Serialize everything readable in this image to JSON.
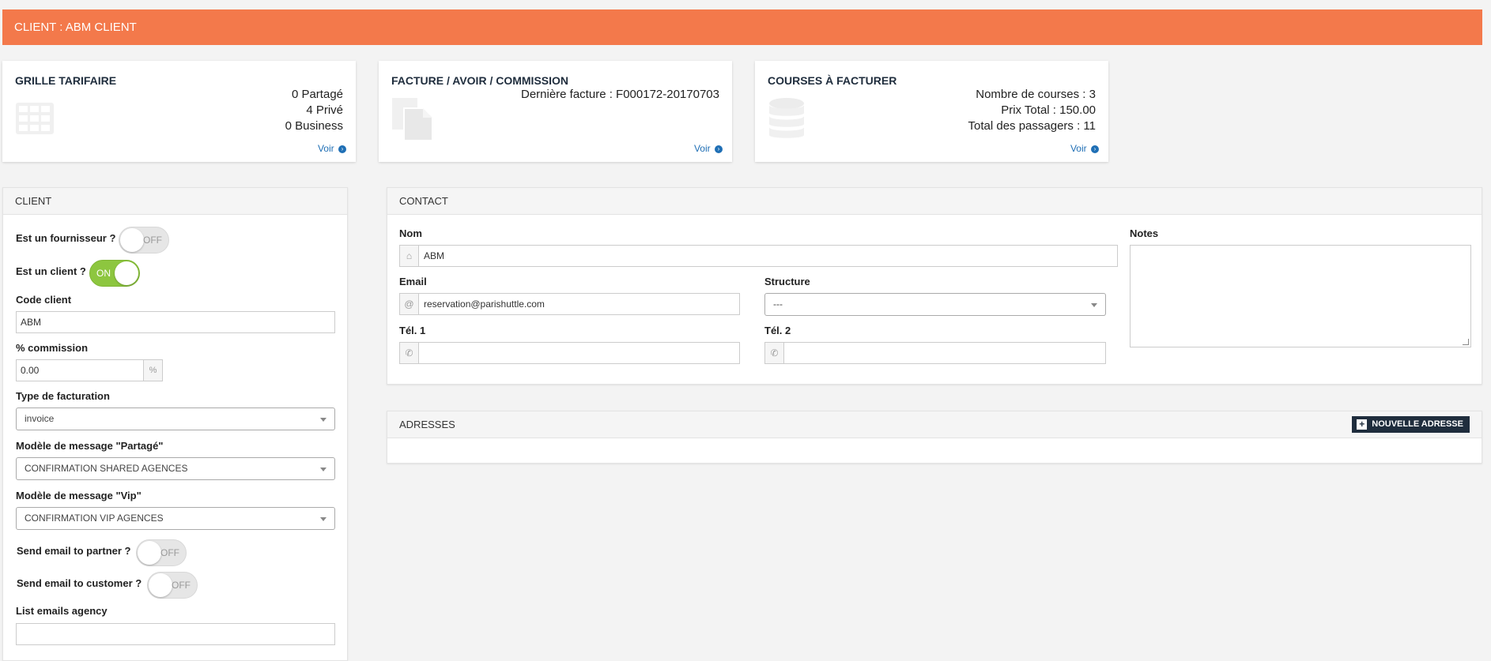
{
  "header": {
    "title": "CLIENT : ABM CLIENT"
  },
  "cards": {
    "grille": {
      "title": "GRILLE TARIFAIRE",
      "lines": [
        "0 Partagé",
        "4 Privé",
        "0 Business"
      ],
      "link": "Voir",
      "icon": "table-icon"
    },
    "facture": {
      "title": "FACTURE / AVOIR / COMMISSION",
      "lines": [
        "Dernière facture : F000172-20170703"
      ],
      "link": "Voir",
      "icon": "files-icon"
    },
    "courses": {
      "title": "COURSES À FACTURER",
      "lines": [
        "Nombre de courses : 3",
        "Prix Total : 150.00",
        "Total des passagers : 11"
      ],
      "link": "Voir",
      "icon": "database-icon"
    }
  },
  "client": {
    "title": "CLIENT",
    "fournisseur": {
      "label": "Est un fournisseur ?",
      "state": "OFF"
    },
    "est_client": {
      "label": "Est un client ?",
      "state": "ON"
    },
    "code": {
      "label": "Code client",
      "value": "ABM"
    },
    "commission": {
      "label": "% commission",
      "value": "0.00",
      "suffix": "%"
    },
    "facturation": {
      "label": "Type de facturation",
      "value": "invoice"
    },
    "modele_partage": {
      "label": "Modèle de message \"Partagé\"",
      "value": "CONFIRMATION SHARED AGENCES"
    },
    "modele_vip": {
      "label": "Modèle de message \"Vip\"",
      "value": "CONFIRMATION VIP AGENCES"
    },
    "email_partner": {
      "label": "Send email to partner ?",
      "state": "OFF"
    },
    "email_customer": {
      "label": "Send email to customer ?",
      "state": "OFF"
    },
    "list_emails": {
      "label": "List emails agency",
      "value": ""
    }
  },
  "contact": {
    "title": "CONTACT",
    "nom": {
      "label": "Nom",
      "value": "ABM",
      "icon": "home-icon"
    },
    "email": {
      "label": "Email",
      "value": "reservation@parishuttle.com",
      "icon": "at-icon"
    },
    "structure": {
      "label": "Structure",
      "value": "---"
    },
    "tel1": {
      "label": "Tél. 1",
      "value": "",
      "icon": "phone-icon"
    },
    "tel2": {
      "label": "Tél. 2",
      "value": "",
      "icon": "phone-icon"
    },
    "notes": {
      "label": "Notes",
      "value": ""
    }
  },
  "adresses": {
    "title": "ADRESSES",
    "button": "NOUVELLE ADRESSE"
  },
  "colors": {
    "header_bg": "#f3794b",
    "toggle_on": "#8dc63f",
    "link": "#1f6fb5",
    "button_dark": "#1f2d3d"
  }
}
